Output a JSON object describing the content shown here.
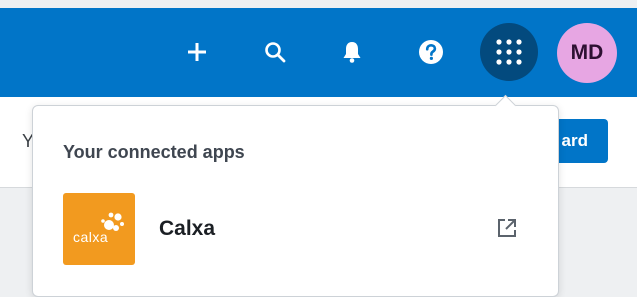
{
  "topbar": {
    "add_icon": "plus-icon",
    "search_icon": "search-icon",
    "notifications_icon": "bell-icon",
    "help_icon": "question-circle-icon",
    "apps_icon": "grid-dots-icon",
    "avatar_initials": "MD",
    "background_color": "#0175c8"
  },
  "subbar": {
    "peek_text": "Y",
    "peek_button_label": "ard"
  },
  "apps_dropdown": {
    "heading": "Your connected apps",
    "apps": [
      {
        "name": "Calxa",
        "logo_text": "calxa",
        "logo_color": "#f29a1f",
        "open_icon": "external-link-icon"
      }
    ]
  }
}
